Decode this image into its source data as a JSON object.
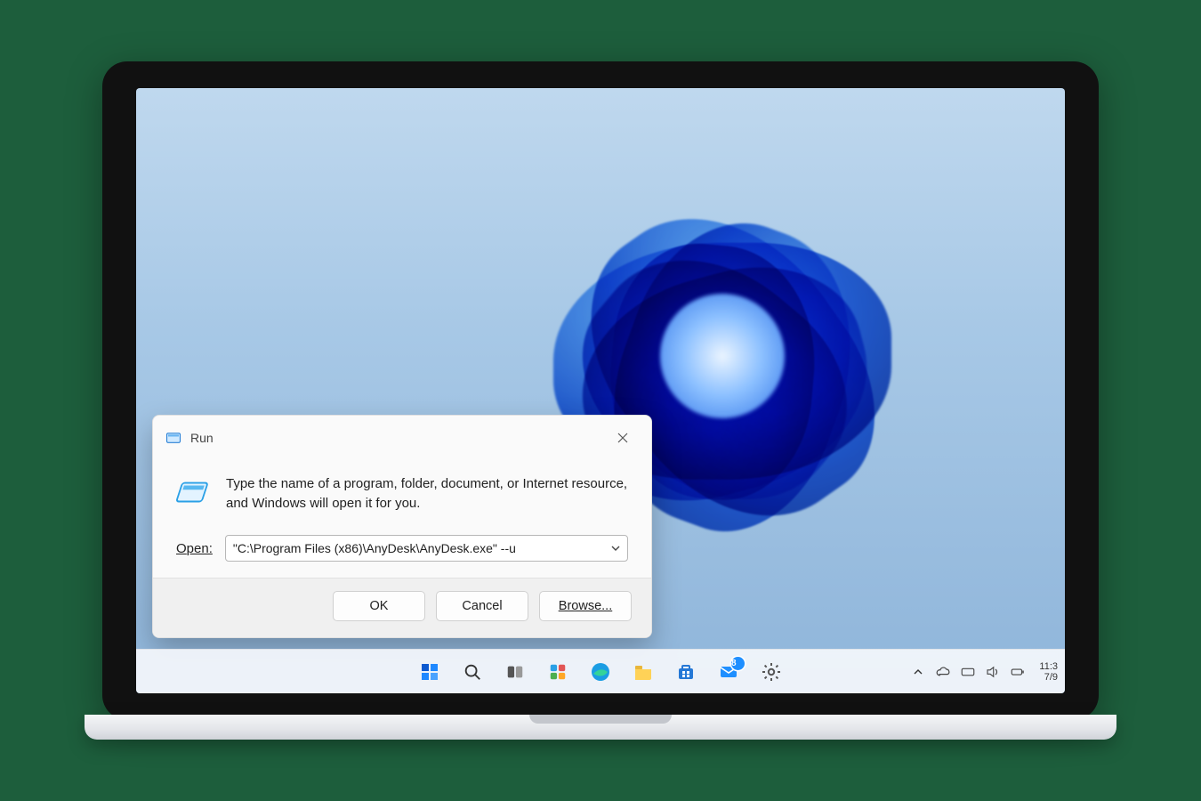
{
  "run_dialog": {
    "title": "Run",
    "description": "Type the name of a program, folder, document, or Internet resource, and Windows will open it for you.",
    "open_label": "Open:",
    "open_label_underline_index": 0,
    "command_value": "\"C:\\Program Files (x86)\\AnyDesk\\AnyDesk.exe\" --u",
    "buttons": {
      "ok": "OK",
      "cancel": "Cancel",
      "browse": "Browse..."
    },
    "browse_underline_index": 0
  },
  "taskbar": {
    "center_items": [
      {
        "name": "start",
        "label": "Start"
      },
      {
        "name": "search",
        "label": "Search"
      },
      {
        "name": "task-view",
        "label": "Task View"
      },
      {
        "name": "widgets",
        "label": "Widgets"
      },
      {
        "name": "edge",
        "label": "Microsoft Edge"
      },
      {
        "name": "file-explorer",
        "label": "File Explorer"
      },
      {
        "name": "microsoft-store",
        "label": "Microsoft Store"
      },
      {
        "name": "mail",
        "label": "Mail",
        "badge": "8"
      },
      {
        "name": "settings",
        "label": "Settings"
      }
    ],
    "tray": [
      {
        "name": "chevron-up",
        "glyph": "^"
      },
      {
        "name": "onedrive",
        "glyph": "cloud"
      },
      {
        "name": "input",
        "glyph": "keyboard"
      },
      {
        "name": "volume",
        "glyph": "volume"
      },
      {
        "name": "battery",
        "glyph": "battery"
      }
    ],
    "clock": {
      "time": "11:3",
      "date": "7/9"
    }
  },
  "colors": {
    "accent": "#0c59cf",
    "taskbar_bg": "#f5f7fc",
    "dialog_bg": "#fafafa",
    "button_border": "#d0d0d0"
  }
}
